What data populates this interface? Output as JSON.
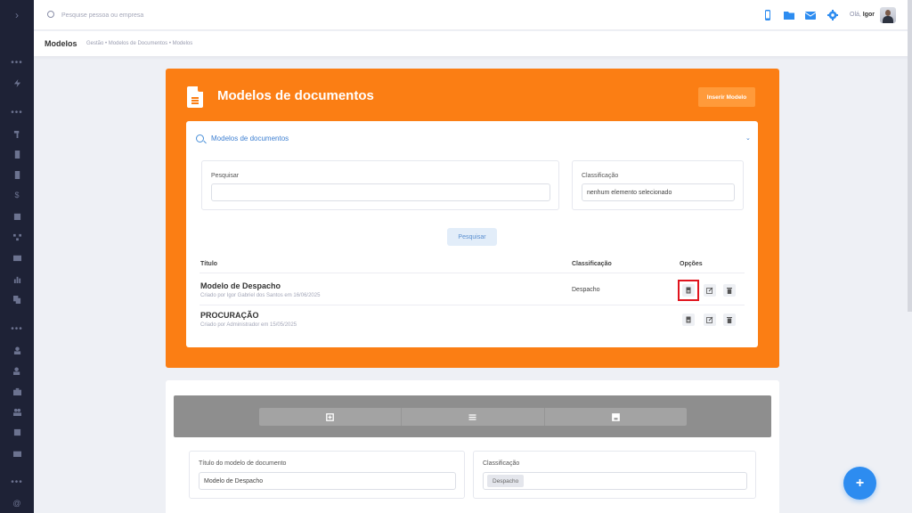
{
  "topbar": {
    "search_placeholder": "Pesquise pessoa ou empresa",
    "greeting_prefix": "Olá,",
    "user_name": "Igor"
  },
  "header": {
    "page_title": "Modelos",
    "breadcrumb": "Gestão  •  Modelos de Documentos  •  Modelos"
  },
  "card": {
    "title": "Modelos de documentos",
    "insert_button": "Inserir Modelo",
    "accordion_title": "Modelos de documentos",
    "search_label": "Pesquisar",
    "search_value": "",
    "class_label": "Classificação",
    "class_value": "nenhum elemento selecionado",
    "search_button": "Pesquisar",
    "table": {
      "headers": [
        "Título",
        "Classificação",
        "Opções"
      ],
      "rows": [
        {
          "title": "Modelo de Despacho",
          "subtitle": "Criado por Igor Gabriel dos Santos em 16/06/2025",
          "classification": "Despacho"
        },
        {
          "title": "PROCURAÇÃO",
          "subtitle": "Criado por Administrador em 15/05/2025",
          "classification": ""
        }
      ]
    }
  },
  "editor": {
    "title_label": "Título do modelo de documento",
    "title_value": "Modelo de Despacho",
    "class_label": "Classificação",
    "class_chip": "Despacho"
  },
  "fab_label": "+",
  "colors": {
    "accent_orange": "#fb7e14",
    "sidebar": "#1e2236",
    "link_blue": "#3d7fd1",
    "fab_blue": "#2d8cf0",
    "highlight_red": "#e0141e"
  }
}
